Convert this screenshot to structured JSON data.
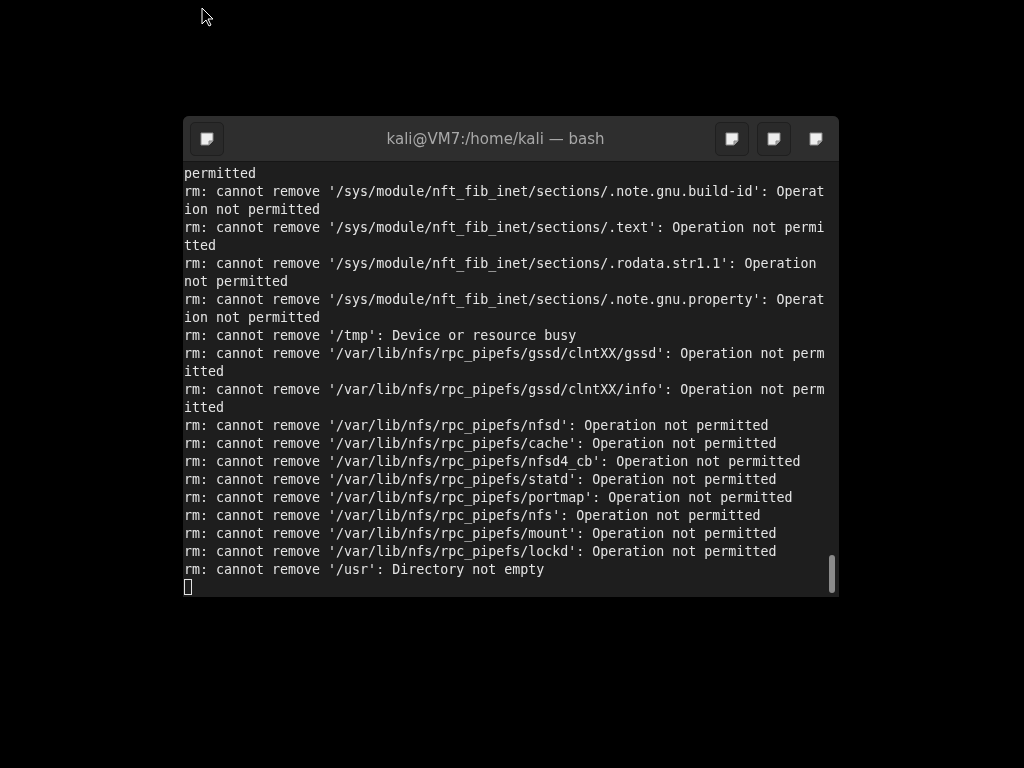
{
  "window": {
    "title": "kali@VM7:/home/kali — bash"
  },
  "terminal": {
    "lines": [
      "permitted",
      "rm: cannot remove '/sys/module/nft_fib_inet/sections/.note.gnu.build-id': Operat",
      "ion not permitted",
      "rm: cannot remove '/sys/module/nft_fib_inet/sections/.text': Operation not permi",
      "tted",
      "rm: cannot remove '/sys/module/nft_fib_inet/sections/.rodata.str1.1': Operation",
      "not permitted",
      "rm: cannot remove '/sys/module/nft_fib_inet/sections/.note.gnu.property': Operat",
      "ion not permitted",
      "rm: cannot remove '/tmp': Device or resource busy",
      "rm: cannot remove '/var/lib/nfs/rpc_pipefs/gssd/clntXX/gssd': Operation not perm",
      "itted",
      "rm: cannot remove '/var/lib/nfs/rpc_pipefs/gssd/clntXX/info': Operation not perm",
      "itted",
      "rm: cannot remove '/var/lib/nfs/rpc_pipefs/nfsd': Operation not permitted",
      "rm: cannot remove '/var/lib/nfs/rpc_pipefs/cache': Operation not permitted",
      "rm: cannot remove '/var/lib/nfs/rpc_pipefs/nfsd4_cb': Operation not permitted",
      "rm: cannot remove '/var/lib/nfs/rpc_pipefs/statd': Operation not permitted",
      "rm: cannot remove '/var/lib/nfs/rpc_pipefs/portmap': Operation not permitted",
      "rm: cannot remove '/var/lib/nfs/rpc_pipefs/nfs': Operation not permitted",
      "rm: cannot remove '/var/lib/nfs/rpc_pipefs/mount': Operation not permitted",
      "rm: cannot remove '/var/lib/nfs/rpc_pipefs/lockd': Operation not permitted",
      "rm: cannot remove '/usr': Directory not empty"
    ]
  }
}
